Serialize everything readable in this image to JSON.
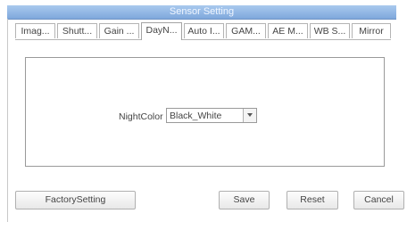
{
  "window": {
    "title": "Sensor Setting"
  },
  "tabs": [
    {
      "label": "Imag..."
    },
    {
      "label": "Shutt..."
    },
    {
      "label": "Gain ..."
    },
    {
      "label": "DayN...",
      "active": true
    },
    {
      "label": "Auto I..."
    },
    {
      "label": "GAM..."
    },
    {
      "label": "AE M..."
    },
    {
      "label": "WB S..."
    },
    {
      "label": "Mirror"
    }
  ],
  "night_color": {
    "label": "NightColor",
    "selected": "Black_White"
  },
  "buttons": {
    "factory": "FactorySetting",
    "save": "Save",
    "reset": "Reset",
    "cancel": "Cancel"
  },
  "icons": {
    "dropdown_arrow": "chevron-down-icon"
  },
  "colors": {
    "titlebar": "#8fb3e3",
    "title_text": "#f0f6ff"
  }
}
